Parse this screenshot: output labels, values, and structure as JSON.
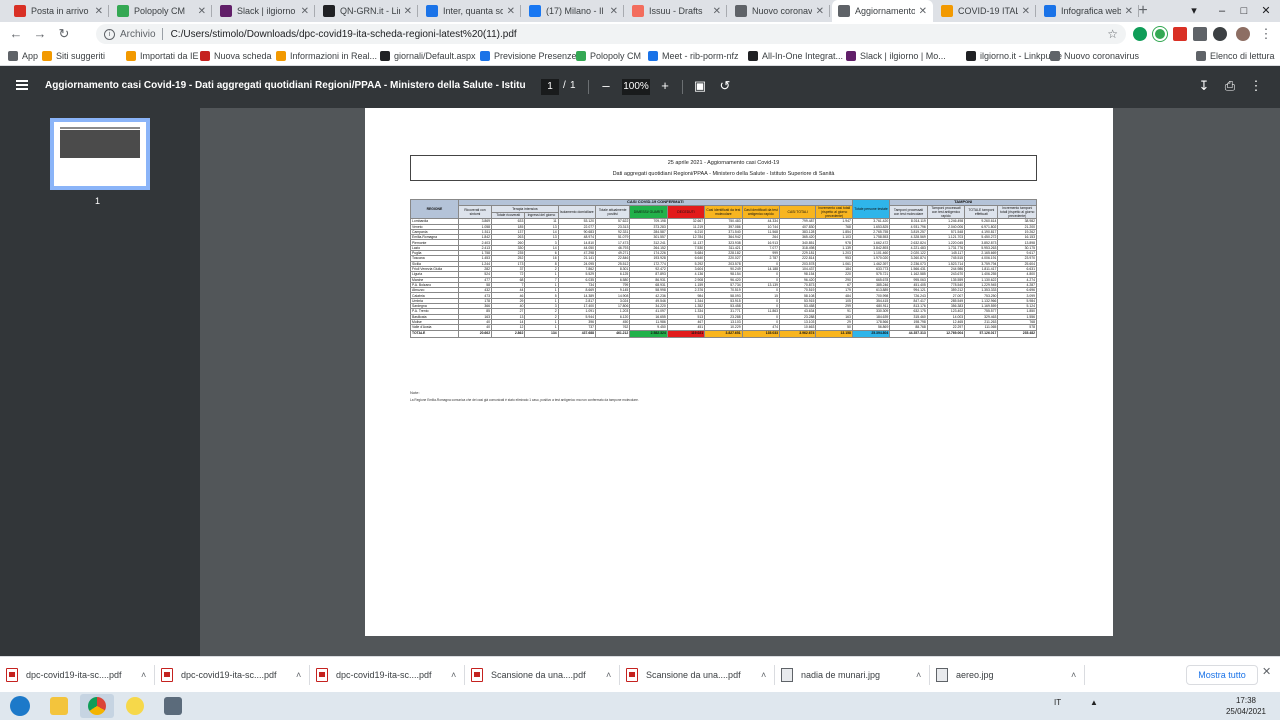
{
  "tabs": [
    {
      "title": "Posta in arrivo (2",
      "color": "#d93025"
    },
    {
      "title": "Polopoly CM",
      "color": "#34a853"
    },
    {
      "title": "Slack | ilgiorno |",
      "color": "#611f69"
    },
    {
      "title": "QN-GRN.it - Lin",
      "color": "#202124"
    },
    {
      "title": "Inter, quanta sof",
      "color": "#1a73e8"
    },
    {
      "title": "(17) Milano - Il G",
      "color": "#1877f2"
    },
    {
      "title": "Issuu - Drafts",
      "color": "#f36d5d"
    },
    {
      "title": "Nuovo coronavir",
      "color": "#5f6368"
    },
    {
      "title": "Aggiornamento",
      "color": "#5f6368"
    },
    {
      "title": "COVID-19 ITALIA",
      "color": "#f29900"
    },
    {
      "title": "Infografica web",
      "color": "#1a73e8"
    }
  ],
  "address": {
    "scheme": "Archivio",
    "url": "C:/Users/stimolo/Downloads/dpc-covid19-ita-scheda-regioni-latest%20(11).pdf"
  },
  "bookmarks": [
    {
      "label": "App",
      "color": "#5f6368"
    },
    {
      "label": "Siti suggeriti",
      "color": "#f29900"
    },
    {
      "label": "Importati da IE",
      "color": "#f29900"
    },
    {
      "label": "Nuova scheda",
      "color": "#c5221f"
    },
    {
      "label": "Informazioni in Real...",
      "color": "#f29900"
    },
    {
      "label": "giornali/Default.aspx",
      "color": "#202124"
    },
    {
      "label": "Previsione Presenze",
      "color": "#1a73e8"
    },
    {
      "label": "Polopoly CM",
      "color": "#34a853"
    },
    {
      "label": "Meet - rib-porm-nfz",
      "color": "#1a73e8"
    },
    {
      "label": "All-In-One Integrat...",
      "color": "#202124"
    },
    {
      "label": "Slack | ilgiorno | Mo...",
      "color": "#611f69"
    },
    {
      "label": "ilgiorno.it - Linkpulse",
      "color": "#202124"
    },
    {
      "label": "Nuovo coronavirus",
      "color": "#5f6368"
    }
  ],
  "reading_list": "Elenco di lettura",
  "pdf": {
    "title": "Aggiornamento casi Covid-19 - Dati aggregati quotidiani Regioni/PPAA - Ministero della Salute - Istituto Superiore ...",
    "page": "1",
    "page_sep": "/",
    "total_pages": "1",
    "zoom": "100%",
    "thumb_label": "1"
  },
  "report": {
    "header_line1": "25 aprile 2021 - Aggiornamento casi Covid-19",
    "header_line2": "Dati aggregati quotidiani Regioni/PPAA - Ministero della Salute - Istituto Superiore di Sanità",
    "group_casi": "CASI COVID-19 CONFERMATI",
    "group_tamponi": "TAMPONI",
    "h_regione": "REGIONE",
    "h_ricoverati": "Ricoverati con sintomi",
    "h_terapia": "Terapia intensiva",
    "h_ti_totale": "Totale ricoverati",
    "h_ti_ingressi": "Ingressi del giorno",
    "h_isolamento": "Isolamento domiciliare",
    "h_positivi": "Totale attualmente positivi",
    "h_guariti": "DIMESSI/ GUARITI",
    "h_deceduti": "DECEDUTI",
    "h_molecolare": "Casi identificati da test molecolare",
    "h_antigenico": "Casi identificati da test antigenico rapido",
    "h_casi_totali": "CASI TOTALI",
    "h_incremento": "Incremento casi totali (rispetto al giorno precedente)",
    "h_persone": "Totale persone testate",
    "h_tamp_mol": "Tamponi processati con test molecolare",
    "h_tamp_ant": "Tamponi processati con test antigenico rapido",
    "h_tamp_tot": "TOTALE tamponi effettuati",
    "h_tamp_inc": "Incremento tamponi totali (rispetto al giorno precedente)",
    "rows": [
      [
        "Lombardia",
        "3.869",
        "633",
        "11",
        "53.120",
        "57.622",
        "709.198",
        "32.667",
        "750.483",
        "44.334",
        "799.487",
        "1.947",
        "3.761.420",
        "8.014.119",
        "1.246.498",
        "9.260.614",
        "38.982"
      ],
      [
        "Veneto",
        "1.058",
        "185",
        "13",
        "22.077",
        "23.313",
        "373.283",
        "11.219",
        "397.086",
        "10.744",
        "407.830",
        "768",
        "1.653.825",
        "4.931.796",
        "2.040.006",
        "6.971.802",
        "21.200"
      ],
      [
        "Campania",
        "1.511",
        "137",
        "14",
        "90.683",
        "92.331",
        "284.587",
        "6.210",
        "371.540",
        "11.568",
        "383.128",
        "1.854",
        "2.765.755",
        "3.819.257",
        "571.548",
        "4.190.817",
        "19.262"
      ],
      [
        "Emilia-Romagna",
        "1.842",
        "263",
        "13",
        "48.974",
        "51.079",
        "301.557",
        "12.784",
        "364.942",
        "264",
        "365.420",
        "1.103",
        "1.758.553",
        "4.328.569",
        "1.121.703",
        "5.450.272",
        "16.153"
      ],
      [
        "Piemonte",
        "2.403",
        "260",
        "3",
        "14.810",
        "17.473",
        "312.241",
        "11.137",
        "323.938",
        "16.913",
        "340.851",
        "978",
        "1.662.472",
        "2.632.824",
        "1.220.045",
        "3.852.873",
        "13.898"
      ],
      [
        "Lazio",
        "2.413",
        "330",
        "14",
        "44.050",
        "46.793",
        "264.152",
        "7.530",
        "311.421",
        "7.077",
        "318.498",
        "1.139",
        "3.842.893",
        "4.221.483",
        "1.731.776",
        "5.953.263",
        "30.175"
      ],
      [
        "Puglia",
        "1.758",
        "235",
        "6",
        "47.298",
        "49.271",
        "174.226",
        "5.684",
        "228.182",
        "999",
        "229.181",
        "1.203",
        "1.101.460",
        "2.020.122",
        "145.117",
        "2.165.669",
        "9.617"
      ],
      [
        "Toscana",
        "1.453",
        "252",
        "16",
        "21.141",
        "22.846",
        "193.928",
        "6.640",
        "220.027",
        "2.787",
        "222.814",
        "953",
        "1.970.020",
        "3.260.874",
        "745.515",
        "4.006.191",
        "23.970"
      ],
      [
        "Sicilia",
        "1.244",
        "173",
        "8",
        "24.095",
        "25.512",
        "172.774",
        "5.292",
        "203.578",
        "0",
        "203.578",
        "1.061",
        "1.462.397",
        "2.236.073",
        "1.523.714",
        "3.759.794",
        "25.604"
      ],
      [
        "Friuli Venezia Giulia",
        "282",
        "37",
        "2",
        "7.862",
        "8.301",
        "92.472",
        "3.604",
        "90.249",
        "14.188",
        "104.437",
        "184",
        "633.773",
        "1.566.431",
        "244.986",
        "1.811.417",
        "6.631"
      ],
      [
        "Liguria",
        "524",
        "72",
        "1",
        "5.529",
        "6.125",
        "87.893",
        "4.136",
        "98.154",
        "0",
        "98.154",
        "220",
        "575.721",
        "1.162.585",
        "243.670",
        "1.406.255",
        "4.800"
      ],
      [
        "Marche",
        "477",
        "68",
        "7",
        "6.035",
        "6.580",
        "86.931",
        "2.908",
        "96.420",
        "0",
        "96.420",
        "290",
        "665.678",
        "995.063",
        "135.559",
        "1.130.622",
        "4.274"
      ],
      [
        "P.A. Bolzano",
        "58",
        "7",
        "1",
        "734",
        "799",
        "68.931",
        "1.159",
        "57.734",
        "13.139",
        "70.873",
        "67",
        "385.246",
        "451.405",
        "778.540",
        "1.229.945",
        "4.287"
      ],
      [
        "Abruzzo",
        "432",
        "44",
        "1",
        "8.669",
        "9.145",
        "58.998",
        "2.376",
        "70.519",
        "0",
        "70.519",
        "179",
        "613.889",
        "994.121",
        "359.212",
        "1.353.333",
        "6.696"
      ],
      [
        "Calabria",
        "473",
        "46",
        "5",
        "14.389",
        "14.908",
        "42.236",
        "984",
        "58.093",
        "15",
        "58.108",
        "484",
        "700.998",
        "726.243",
        "27.007",
        "753.250",
        "3.099"
      ],
      [
        "Umbria",
        "178",
        "29",
        "1",
        "2.817",
        "3.024",
        "49.546",
        "1.344",
        "53.915",
        "0",
        "53.915",
        "105",
        "354.415",
        "847.417",
        "285.549",
        "1.132.966",
        "5.984"
      ],
      [
        "Sardegna",
        "366",
        "40",
        "3",
        "17.400",
        "17.806",
        "34.220",
        "1.352",
        "53.458",
        "0",
        "53.458",
        "299",
        "680.911",
        "813.176",
        "356.383",
        "1.169.559",
        "5.124"
      ],
      [
        "P.A. Trento",
        "85",
        "27",
        "2",
        "1.091",
        "1.203",
        "41.097",
        "1.334",
        "31.771",
        "11.863",
        "43.634",
        "91",
        "330.309",
        "632.175",
        "123.402",
        "755.577",
        "1.850"
      ],
      [
        "Basilicata",
        "163",
        "13",
        "2",
        "5.944",
        "6.120",
        "16.655",
        "513",
        "23.288",
        "0",
        "23.288",
        "163",
        "184.639",
        "315.460",
        "14.003",
        "329.463",
        "1.556"
      ],
      [
        "Molise",
        "40",
        "14",
        "1",
        "396",
        "450",
        "11.986",
        "467",
        "13.103",
        "0",
        "13.103",
        "29",
        "178.566",
        "198.798",
        "12.465",
        "211.263",
        "768"
      ],
      [
        "Valle d'Aosta",
        "40",
        "12",
        "1",
        "737",
        "762",
        "9.450",
        "451",
        "10.229",
        "474",
        "10.663",
        "50",
        "56.869",
        "88.768",
        "22.297",
        "111.065",
        "578"
      ]
    ],
    "total": [
      "TOTALE",
      "20.662",
      "2.862",
      "134",
      "437.688",
      "461.212",
      "2.582.324",
      "119.021",
      "3.827.651",
      "135.033",
      "3.962.674",
      "13.158",
      "25.394.804",
      "44.357.313",
      "12.769.004",
      "57.126.017",
      "235.482"
    ],
    "note_label": "Note:",
    "note_text": "La Regione Emilia-Romagna comunica che dei casi già comunicati è stato eliminato 1 caso, positivo a test antigenico ma non confermato da tampone molecolare."
  },
  "downloads": [
    {
      "name": "dpc-covid19-ita-sc....pdf",
      "type": "pdf"
    },
    {
      "name": "dpc-covid19-ita-sc....pdf",
      "type": "pdf"
    },
    {
      "name": "dpc-covid19-ita-sc....pdf",
      "type": "pdf"
    },
    {
      "name": "Scansione da una....pdf",
      "type": "pdf"
    },
    {
      "name": "Scansione da una....pdf",
      "type": "pdf"
    },
    {
      "name": "nadia de munari.jpg",
      "type": "img"
    },
    {
      "name": "aereo.jpg",
      "type": "img"
    }
  ],
  "downloads_show_all": "Mostra tutto",
  "taskbar": {
    "lang": "IT",
    "time": "17:38",
    "date": "25/04/2021"
  }
}
